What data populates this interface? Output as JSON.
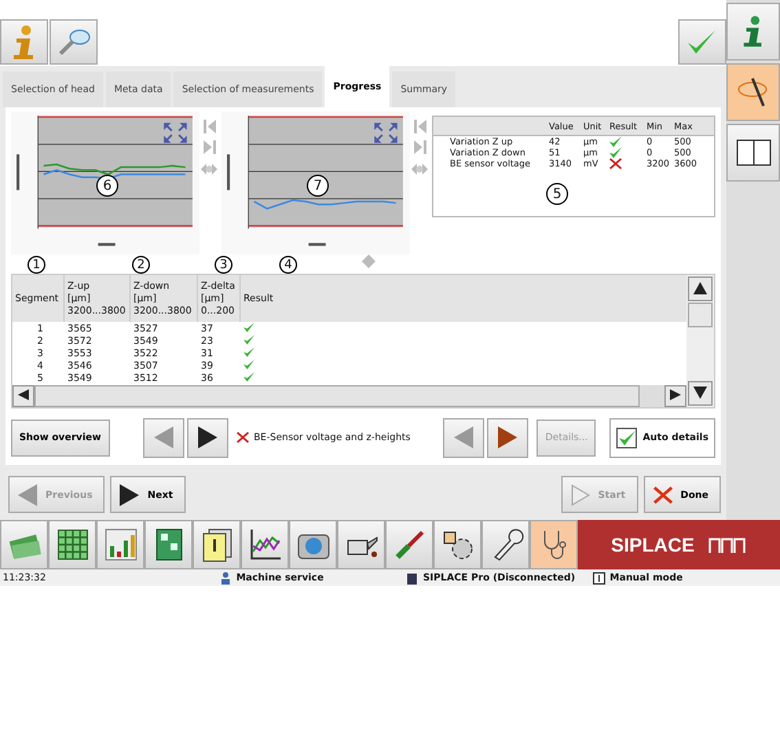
{
  "tabs": [
    {
      "label": "Selection of head",
      "selected": false
    },
    {
      "label": "Meta data",
      "selected": false
    },
    {
      "label": "Selection of measurements",
      "selected": false
    },
    {
      "label": "Progress",
      "selected": true
    },
    {
      "label": "Summary",
      "selected": false
    }
  ],
  "charts": [
    {
      "callout": "6",
      "kind": "double"
    },
    {
      "callout": "7",
      "kind": "single"
    }
  ],
  "results": {
    "callout": "5",
    "columns": [
      "Value",
      "Unit",
      "Result",
      "Min",
      "Max"
    ],
    "rows": [
      {
        "name": "Variation Z up",
        "value": "42",
        "unit": "µm",
        "passed": true,
        "min": "0",
        "max": "500"
      },
      {
        "name": "Variation Z down",
        "value": "51",
        "unit": "µm",
        "passed": true,
        "min": "0",
        "max": "500"
      },
      {
        "name": "BE sensor voltage",
        "value": "3140",
        "unit": "mV",
        "passed": false,
        "min": "3200",
        "max": "3600"
      }
    ]
  },
  "callouts": [
    "1",
    "2",
    "3",
    "4"
  ],
  "segments": {
    "columns": [
      [
        "Segment"
      ],
      [
        "Z-up",
        "[µm]",
        "3200...3800"
      ],
      [
        "Z-down",
        "[µm]",
        "3200...3800"
      ],
      [
        "Z-delta",
        "[µm]",
        "0...200"
      ],
      [
        "Result"
      ]
    ],
    "rows": [
      {
        "segment": "1",
        "z_up": "3565",
        "z_down": "3527",
        "z_delta": "37",
        "passed": true
      },
      {
        "segment": "2",
        "z_up": "3572",
        "z_down": "3549",
        "z_delta": "23",
        "passed": true
      },
      {
        "segment": "3",
        "z_up": "3553",
        "z_down": "3522",
        "z_delta": "31",
        "passed": true
      },
      {
        "segment": "4",
        "z_up": "3546",
        "z_down": "3507",
        "z_delta": "39",
        "passed": true
      },
      {
        "segment": "5",
        "z_up": "3549",
        "z_down": "3512",
        "z_delta": "36",
        "passed": true
      }
    ]
  },
  "controls": {
    "show_overview": "Show overview",
    "status_text": "BE-Sensor voltage and z-heights",
    "status_ok": false,
    "details": {
      "label": "Details...",
      "disabled": true
    },
    "auto_details": {
      "label": "Auto details",
      "checked": true
    }
  },
  "nav": [
    {
      "label": "Previous",
      "kind": "back",
      "disabled": true
    },
    {
      "label": "Next",
      "kind": "forward",
      "disabled": false
    },
    {
      "label": "Start",
      "kind": "start",
      "disabled": true
    },
    {
      "label": "Done",
      "kind": "done",
      "disabled": false
    }
  ],
  "logo": "SIPLACE",
  "status_bar": {
    "time": "11:23:32",
    "items": [
      "Machine service",
      "SIPLACE Pro (Disconnected)",
      "Manual mode"
    ]
  }
}
